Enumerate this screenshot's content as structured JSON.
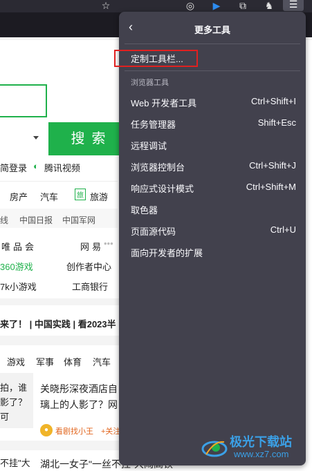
{
  "browser": {
    "menu_button_icon": "hamburger-menu-icon"
  },
  "page": {
    "search_button": "搜索",
    "links_row1": [
      "简登录",
      "腾讯视频"
    ],
    "nav_row": [
      "房产",
      "汽车",
      "旅游"
    ],
    "news_sources": [
      "线",
      "中国日报",
      "中国军网"
    ],
    "grid_row1": [
      "唯品会",
      "网易"
    ],
    "grid_row2": [
      "360游戏",
      "创作者中心"
    ],
    "grid_row3": [
      "7k小游戏",
      "工商银行"
    ],
    "banner_text": "来了！ | 中国实践 | 看2023半",
    "tabs": [
      "游戏",
      "军事",
      "体育",
      "汽车"
    ],
    "article1_left": [
      "拍，谁",
      "影了？",
      "可"
    ],
    "article1_title": [
      "关晓彤深夜酒店自",
      "璃上的人影了？网"
    ],
    "article1_author": "看剧找小王",
    "article1_follow": "+关注",
    "article2_left": "不挂\"大",
    "article2_title": "湖北一女子\"一丝不挂\"大闹高铁"
  },
  "menu": {
    "title": "更多工具",
    "customize": "定制工具栏...",
    "section_label": "浏览器工具",
    "items": [
      {
        "label": "Web 开发者工具",
        "shortcut": "Ctrl+Shift+I"
      },
      {
        "label": "任务管理器",
        "shortcut": "Shift+Esc"
      },
      {
        "label": "远程调试",
        "shortcut": ""
      },
      {
        "label": "浏览器控制台",
        "shortcut": "Ctrl+Shift+J"
      },
      {
        "label": "响应式设计模式",
        "shortcut": "Ctrl+Shift+M"
      },
      {
        "label": "取色器",
        "shortcut": ""
      },
      {
        "label": "页面源代码",
        "shortcut": "Ctrl+U"
      },
      {
        "label": "面向开发者的扩展",
        "shortcut": ""
      }
    ]
  },
  "watermark": {
    "name": "极光下载站",
    "url": "www.xz7.com"
  },
  "colors": {
    "accent_green": "#1fb14b",
    "menu_bg": "#42414d",
    "highlight": "#e02020"
  }
}
